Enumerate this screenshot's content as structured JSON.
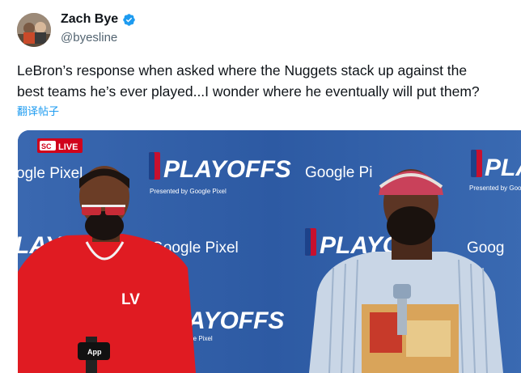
{
  "author": {
    "display_name": "Zach Bye",
    "handle": "@byesline"
  },
  "tweet": {
    "text_line1": "LeBron’s response when asked where the Nuggets stack up against the",
    "text_line2": "best teams he’s ever played...I wonder where he eventually will put them?",
    "translate_label": "翻译帖子"
  },
  "media": {
    "live_badge": "LIVE",
    "network": "SC",
    "backdrop": {
      "playoffs": "PLAYOFFS",
      "presented": "Presented by Google Pixel",
      "sponsor": "Google Pixel",
      "sponsor_left_partial": "ogle Pixel",
      "sponsor_right_partial": "Google Pi",
      "playoffs_partial_left": "LAYO",
      "playoffs_partial_mid": "PLAYO",
      "playoffs_partial_low": "AYOFFS",
      "sponsor_low_partial": "ogle Pixel",
      "pla_right": "PLA",
      "goog_right": "Goog",
      "presented_right": "Presented by Goog"
    },
    "shirt_text": "LV",
    "mic_label": "App"
  },
  "colors": {
    "backdrop_blue": "#2e5ea8",
    "verified_blue": "#1d9bf0",
    "link_blue": "#1d9bf0",
    "handle_gray": "#536471"
  }
}
